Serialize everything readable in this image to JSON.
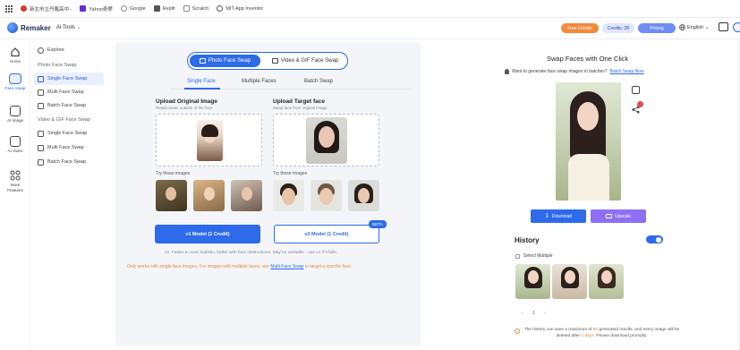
{
  "bookmarks": [
    {
      "label": "",
      "icon": "apps-grid-icon",
      "color": "#555555"
    },
    {
      "label": "新北市立丹鳳高中 -",
      "icon": "school-bookmark-icon",
      "color": "#d33b2f"
    },
    {
      "label": "Yahoo奇摩",
      "icon": "yahoo-icon",
      "color": "#6b2bd6"
    },
    {
      "label": "Google",
      "icon": "google-icon",
      "color": "#777777"
    },
    {
      "label": "Replit",
      "icon": "replit-icon",
      "color": "#555555"
    },
    {
      "label": "Scratch",
      "icon": "scratch-icon",
      "color": "#777777"
    },
    {
      "label": "MIT App Inventor",
      "icon": "mit-app-inventor-icon",
      "color": "#555555"
    }
  ],
  "header": {
    "brand": "Remaker",
    "ai_tools": "AI Tools",
    "free_credits": "Free Credits",
    "credits": "Credits: 28",
    "pricing": "Pricing",
    "language": "English",
    "colors": {
      "free_credits": "#f28a3c",
      "credits_bg": "#dfe6ff",
      "pricing": "#6f8df5"
    }
  },
  "rail": [
    {
      "label": "Home",
      "icon": "home-icon"
    },
    {
      "label": "Face Swap",
      "icon": "face-swap-icon"
    },
    {
      "label": "AI Image",
      "icon": "image-icon"
    },
    {
      "label": "AI Video",
      "icon": "video-icon"
    },
    {
      "label": "More Features",
      "icon": "more-grid-icon"
    }
  ],
  "subnav": {
    "explore": "Explore",
    "photo_group": "Photo Face Swap",
    "photo_items": [
      "Single Face Swap",
      "Multi Face Swap",
      "Batch Face Swap"
    ],
    "video_group": "Video & GIF Face Swap",
    "video_items": [
      "Single Face Swap",
      "Multi Face Swap",
      "Batch Face Swap"
    ]
  },
  "main": {
    "mode_tabs": [
      "Photo Face Swap",
      "Video & GIF Face Swap"
    ],
    "sub_tabs": [
      "Single Face",
      "Multiple Faces",
      "Batch Swap"
    ],
    "upload_original": {
      "title": "Upload Original Image",
      "subtitle": "Retain areas outside of the face"
    },
    "upload_target": {
      "title": "Upload Target face",
      "subtitle": "Swap face from original image"
    },
    "try_label": "Try those images",
    "v1_button": "v1 Model (1 Credit)",
    "v2_button": "v2 Model (1 Credit)",
    "beta": "BETA",
    "note": "v2: Faster & more realistic, better with face obstructions. May be unstable - use v1 if it fails.",
    "warning_pre": "Only works with single-face images. For images with multiple faces, use ",
    "warning_link": "Multi Face Swap",
    "warning_post": " to target a specific face."
  },
  "right": {
    "title": "Swap Faces with One Click",
    "batch_prompt": "Want to generate face swap images in batches?",
    "batch_link": "Batch Swap Now",
    "download": "Download",
    "upscale": "Upscale",
    "history": "History",
    "select_multiple": "Select Multiple",
    "page": "1",
    "history_note_pre": "The history can save a maximum of ",
    "history_note_max": "60",
    "history_note_mid": " generated results, and every image will be deleted after ",
    "history_note_days": "1 days",
    "history_note_post": ". Please download promptly."
  }
}
